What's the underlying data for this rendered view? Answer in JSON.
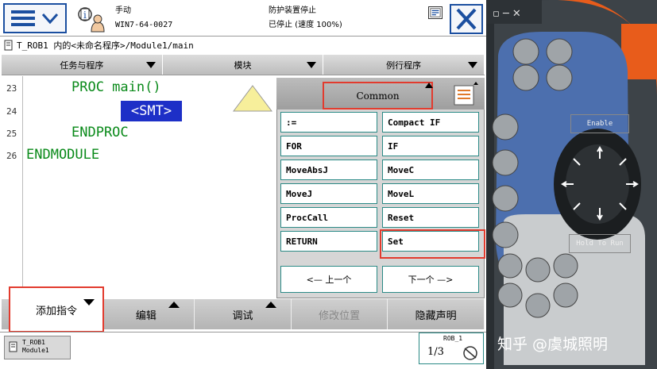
{
  "header": {
    "mode": "手动",
    "controller": "WIN7-64-0027",
    "safety_status": "防护装置停止",
    "run_status": "已停止 (速度 100%)"
  },
  "path": "T_ROB1 内的<未命名程序>/Module1/main",
  "tabs": [
    {
      "label": "任务与程序"
    },
    {
      "label": "模块"
    },
    {
      "label": "例行程序"
    }
  ],
  "editor": {
    "line_numbers": [
      "23",
      "24",
      "25",
      "26"
    ],
    "lines": [
      "PROC main()",
      "<SMT>",
      "ENDPROC",
      "ENDMODULE"
    ]
  },
  "picker": {
    "category": "Common",
    "instructions": [
      ":=",
      "Compact IF",
      "FOR",
      "IF",
      "MoveAbsJ",
      "MoveC",
      "MoveJ",
      "MoveL",
      "ProcCall",
      "Reset",
      "RETURN",
      "Set"
    ],
    "prev_label": "<—  上一个",
    "next_label": "下一个  —>"
  },
  "actions": {
    "add_instruction": "添加指令",
    "edit": "编辑",
    "debug": "调试",
    "modify_position": "修改位置",
    "hide_declarations": "隐藏声明"
  },
  "statusbar": {
    "task_line1": "T_ROB1",
    "task_line2": "Module1",
    "robot": "ROB_1",
    "fraction": "1/3"
  },
  "pendant": {
    "enable_label": "Enable",
    "hold_label": "Hold To Run",
    "watermark": "知乎 @虞城照明"
  },
  "colors": {
    "accent_blue": "#1b4fa0",
    "code_green": "#0a8a1a",
    "highlight_red": "#e23b2e",
    "selection_blue": "#1d2fc7",
    "button_border": "#2b8a86"
  }
}
